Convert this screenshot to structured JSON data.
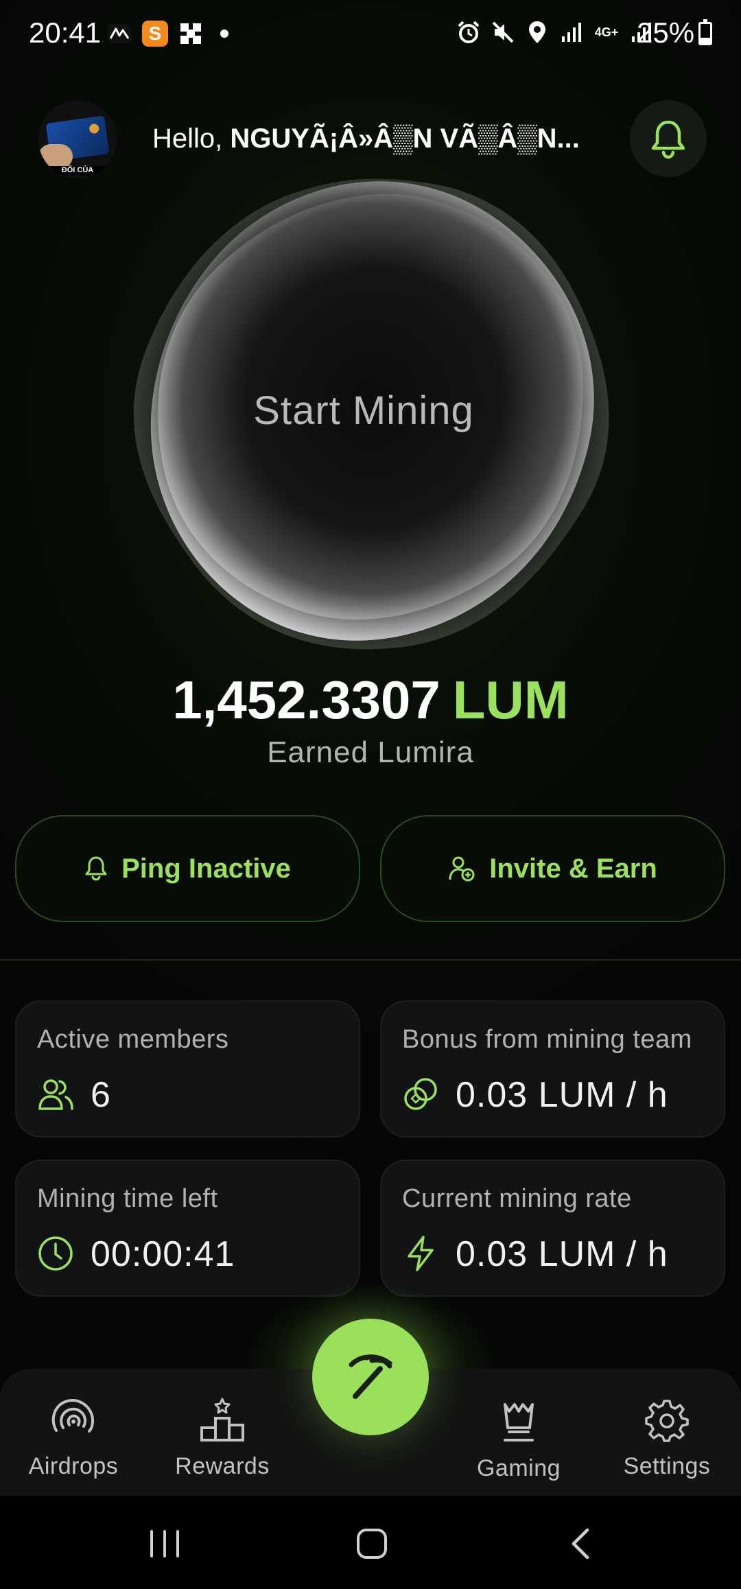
{
  "status_bar": {
    "time": "20:41",
    "battery_text": "25%",
    "left_icons": [
      "activity-icon",
      "s-app-icon",
      "grid-app-icon",
      "notification-dot"
    ],
    "right_icons": [
      "alarm-icon",
      "mute-icon",
      "location-icon",
      "signal-icon",
      "4g-plus-icon",
      "signal-icon"
    ],
    "s_badge_letter": "S",
    "network_label": "4G+"
  },
  "header": {
    "greeting": "Hello,",
    "user_name": "NGUYÃ¡Â»Â▒N VÃ▒Â▒N...",
    "avatar_caption": "ĐỐI CỦA"
  },
  "mining": {
    "button_label": "Start Mining"
  },
  "balance": {
    "value": "1,452.3307",
    "unit": "LUM",
    "caption": "Earned Lumira"
  },
  "actions": {
    "ping_label": "Ping Inactive",
    "invite_label": "Invite & Earn"
  },
  "stats": {
    "active_members": {
      "label": "Active members",
      "value": "6"
    },
    "bonus": {
      "label": "Bonus from mining team",
      "value": "0.03 LUM / h"
    },
    "time_left": {
      "label": "Mining time left",
      "value": "00:00:41"
    },
    "rate": {
      "label": "Current mining rate",
      "value": "0.03 LUM / h"
    }
  },
  "nav": {
    "airdrops": "Airdrops",
    "rewards": "Rewards",
    "gaming": "Gaming",
    "settings": "Settings"
  },
  "colors": {
    "accent": "#9be15d",
    "background": "#060a05",
    "card": "#121314"
  }
}
